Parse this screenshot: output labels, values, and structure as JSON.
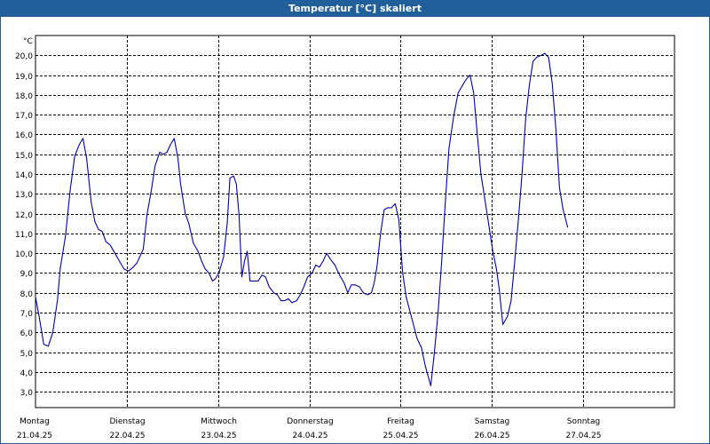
{
  "window": {
    "title": "Temperatur [°C] skaliert"
  },
  "chart_data": {
    "type": "line",
    "title": "Temperatur [°C] skaliert",
    "ylabel": "°C",
    "xlabel": "",
    "ylim": [
      2.2,
      21.0
    ],
    "xlim": [
      0,
      7.0
    ],
    "grid": true,
    "grid_style": "dashed",
    "line_color": "#0000aa",
    "y_ticks": [
      "3,0",
      "4,0",
      "5,0",
      "6,0",
      "7,0",
      "8,0",
      "9,0",
      "10,0",
      "11,0",
      "12,0",
      "13,0",
      "14,0",
      "15,0",
      "16,0",
      "17,0",
      "18,0",
      "19,0",
      "20,0"
    ],
    "days": [
      {
        "name": "Montag",
        "date": "21.04.25"
      },
      {
        "name": "Dienstag",
        "date": "22.04.25"
      },
      {
        "name": "Mittwoch",
        "date": "23.04.25"
      },
      {
        "name": "Donnerstag",
        "date": "24.04.25"
      },
      {
        "name": "Freitag",
        "date": "25.04.25"
      },
      {
        "name": "Samstag",
        "date": "26.04.25"
      },
      {
        "name": "Sonntag",
        "date": "27.04.25"
      }
    ],
    "series": [
      {
        "points": [
          [
            0.0,
            7.8
          ],
          [
            0.04,
            6.8
          ],
          [
            0.09,
            5.4
          ],
          [
            0.14,
            5.3
          ],
          [
            0.19,
            6.0
          ],
          [
            0.24,
            7.6
          ],
          [
            0.27,
            9.2
          ],
          [
            0.33,
            10.9
          ],
          [
            0.38,
            13.2
          ],
          [
            0.43,
            14.9
          ],
          [
            0.48,
            15.5
          ],
          [
            0.52,
            15.8
          ],
          [
            0.56,
            14.8
          ],
          [
            0.61,
            12.6
          ],
          [
            0.65,
            11.6
          ],
          [
            0.69,
            11.2
          ],
          [
            0.73,
            11.1
          ],
          [
            0.77,
            10.6
          ],
          [
            0.82,
            10.4
          ],
          [
            0.87,
            10.0
          ],
          [
            0.92,
            9.6
          ],
          [
            0.97,
            9.2
          ],
          [
            1.02,
            9.1
          ],
          [
            1.07,
            9.3
          ],
          [
            1.11,
            9.5
          ],
          [
            1.14,
            9.8
          ],
          [
            1.18,
            10.2
          ],
          [
            1.22,
            11.9
          ],
          [
            1.27,
            13.2
          ],
          [
            1.31,
            14.4
          ],
          [
            1.36,
            15.1
          ],
          [
            1.4,
            15.0
          ],
          [
            1.44,
            15.1
          ],
          [
            1.48,
            15.5
          ],
          [
            1.52,
            15.8
          ],
          [
            1.56,
            14.8
          ],
          [
            1.59,
            13.5
          ],
          [
            1.64,
            12.0
          ],
          [
            1.68,
            11.5
          ],
          [
            1.73,
            10.5
          ],
          [
            1.78,
            10.1
          ],
          [
            1.82,
            9.6
          ],
          [
            1.86,
            9.2
          ],
          [
            1.9,
            9.0
          ],
          [
            1.94,
            8.6
          ],
          [
            1.97,
            8.7
          ],
          [
            2.01,
            9.0
          ],
          [
            2.06,
            9.8
          ],
          [
            2.1,
            11.5
          ],
          [
            2.13,
            13.8
          ],
          [
            2.17,
            13.9
          ],
          [
            2.2,
            13.5
          ],
          [
            2.23,
            11.9
          ],
          [
            2.26,
            8.8
          ],
          [
            2.29,
            9.6
          ],
          [
            2.32,
            10.1
          ],
          [
            2.35,
            8.6
          ],
          [
            2.4,
            8.6
          ],
          [
            2.44,
            8.6
          ],
          [
            2.48,
            8.9
          ],
          [
            2.52,
            8.8
          ],
          [
            2.56,
            8.3
          ],
          [
            2.61,
            8.0
          ],
          [
            2.65,
            7.9
          ],
          [
            2.69,
            7.6
          ],
          [
            2.73,
            7.6
          ],
          [
            2.77,
            7.7
          ],
          [
            2.81,
            7.5
          ],
          [
            2.86,
            7.6
          ],
          [
            2.9,
            7.9
          ],
          [
            2.94,
            8.3
          ],
          [
            2.98,
            8.8
          ],
          [
            3.03,
            9.0
          ],
          [
            3.07,
            9.4
          ],
          [
            3.11,
            9.3
          ],
          [
            3.15,
            9.6
          ],
          [
            3.19,
            10.0
          ],
          [
            3.23,
            9.7
          ],
          [
            3.28,
            9.4
          ],
          [
            3.33,
            8.9
          ],
          [
            3.38,
            8.5
          ],
          [
            3.42,
            8.0
          ],
          [
            3.46,
            8.4
          ],
          [
            3.5,
            8.4
          ],
          [
            3.55,
            8.3
          ],
          [
            3.59,
            8.0
          ],
          [
            3.64,
            7.9
          ],
          [
            3.68,
            8.0
          ],
          [
            3.71,
            8.5
          ],
          [
            3.74,
            9.3
          ],
          [
            3.78,
            11.0
          ],
          [
            3.82,
            12.2
          ],
          [
            3.86,
            12.3
          ],
          [
            3.9,
            12.3
          ],
          [
            3.94,
            12.5
          ],
          [
            3.98,
            11.7
          ],
          [
            4.02,
            9.1
          ],
          [
            4.06,
            7.8
          ],
          [
            4.1,
            7.1
          ],
          [
            4.14,
            6.4
          ],
          [
            4.18,
            5.7
          ],
          [
            4.23,
            5.2
          ],
          [
            4.27,
            4.3
          ],
          [
            4.3,
            3.8
          ],
          [
            4.33,
            3.3
          ],
          [
            4.37,
            5.0
          ],
          [
            4.41,
            7.0
          ],
          [
            4.45,
            9.6
          ],
          [
            4.49,
            12.6
          ],
          [
            4.53,
            15.3
          ],
          [
            4.58,
            16.9
          ],
          [
            4.63,
            18.1
          ],
          [
            4.68,
            18.5
          ],
          [
            4.72,
            18.8
          ],
          [
            4.76,
            19.0
          ],
          [
            4.8,
            18.1
          ],
          [
            4.84,
            16.0
          ],
          [
            4.88,
            14.0
          ],
          [
            4.93,
            12.5
          ],
          [
            4.97,
            11.3
          ],
          [
            5.01,
            10.1
          ],
          [
            5.05,
            9.2
          ],
          [
            5.08,
            8.2
          ],
          [
            5.12,
            6.4
          ],
          [
            5.17,
            6.8
          ],
          [
            5.21,
            7.6
          ],
          [
            5.25,
            9.6
          ],
          [
            5.29,
            11.7
          ],
          [
            5.33,
            14.0
          ],
          [
            5.37,
            16.8
          ],
          [
            5.41,
            18.5
          ],
          [
            5.45,
            19.7
          ],
          [
            5.49,
            19.9
          ],
          [
            5.54,
            20.0
          ],
          [
            5.58,
            20.1
          ],
          [
            5.62,
            19.9
          ],
          [
            5.66,
            18.6
          ],
          [
            5.7,
            16.3
          ],
          [
            5.74,
            13.3
          ],
          [
            5.78,
            12.2
          ],
          [
            5.83,
            11.3
          ]
        ]
      }
    ]
  }
}
